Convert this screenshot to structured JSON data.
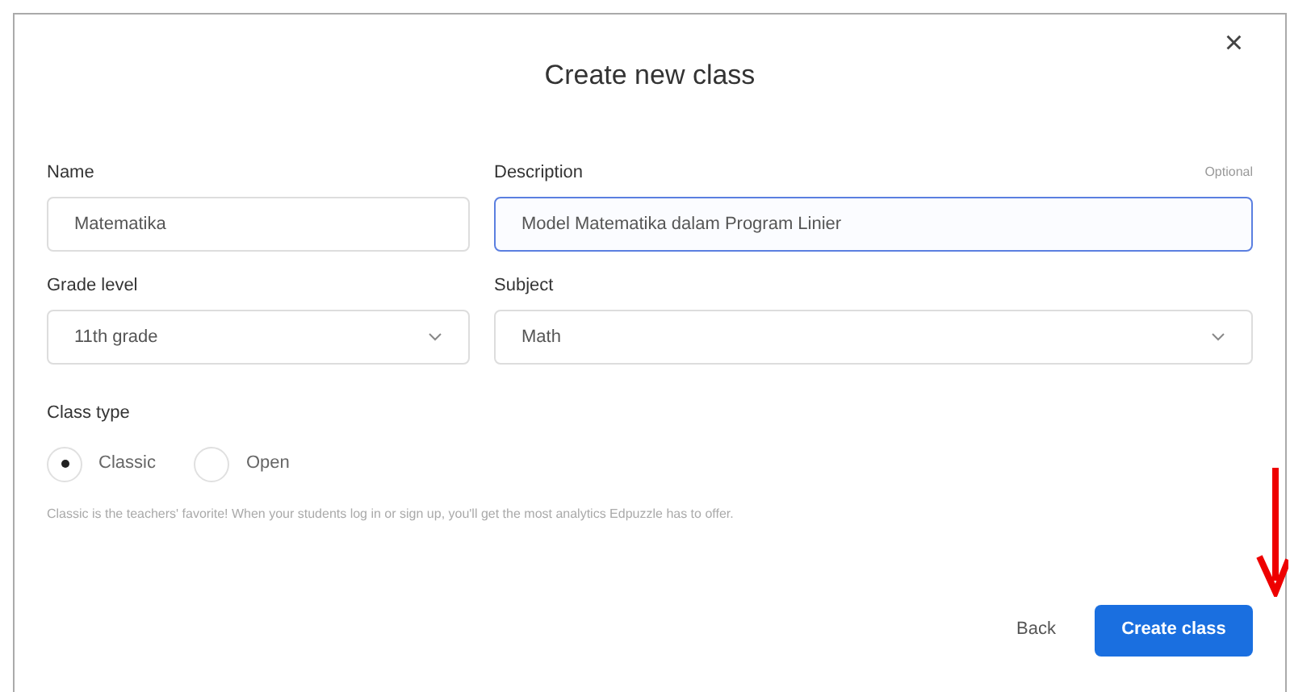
{
  "dialog": {
    "title": "Create new class",
    "close": "×"
  },
  "fields": [
    {
      "label": "Name",
      "value": "Matematika",
      "kind": "text",
      "focused": false
    },
    {
      "label": "Description",
      "optional": "Optional",
      "value": "Model Matematika dalam Program Linier",
      "kind": "text",
      "focused": true
    },
    {
      "label": "Grade level",
      "value": "11th grade",
      "kind": "select"
    },
    {
      "label": "Subject",
      "value": "Math",
      "kind": "select"
    }
  ],
  "class_type": {
    "label": "Class type",
    "options": [
      {
        "label": "Classic",
        "selected": true
      },
      {
        "label": "Open",
        "selected": false
      }
    ],
    "help": "Classic is the teachers' favorite! When your students log in or sign up, you'll get the most analytics Edpuzzle has to offer."
  },
  "buttons": {
    "back": "Back",
    "create": "Create class"
  }
}
